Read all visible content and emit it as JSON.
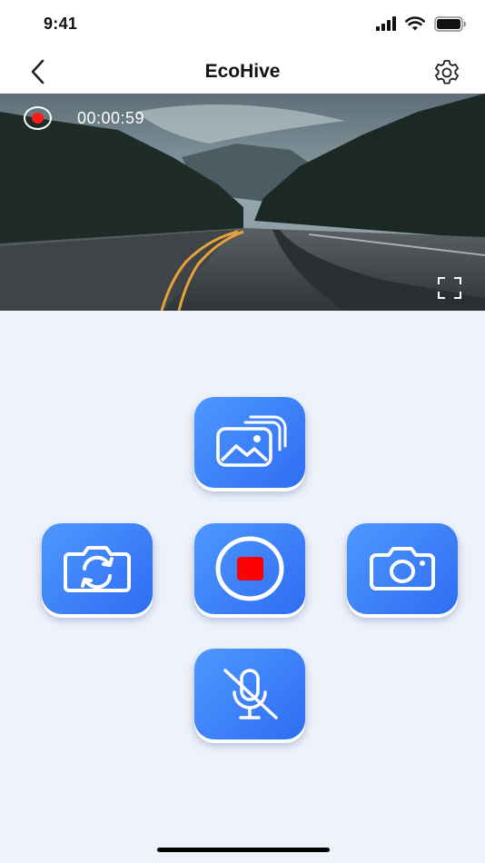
{
  "status_bar": {
    "time": "9:41",
    "icons": [
      "cellular-signal-icon",
      "wifi-icon",
      "battery-icon"
    ]
  },
  "nav": {
    "title": "EcoHive",
    "back_icon": "chevron-left-icon",
    "settings_icon": "gear-icon"
  },
  "video": {
    "recording_indicator_color": "#ff1a1a",
    "timer": "00:00:59",
    "fullscreen_icon": "fullscreen-icon"
  },
  "controls": {
    "accent_color": "#3b7ff7",
    "gallery": {
      "icon": "gallery-icon"
    },
    "flip_camera": {
      "icon": "flip-camera-icon"
    },
    "record": {
      "icon": "stop-record-icon",
      "stop_color": "#ff0000"
    },
    "take_photo": {
      "icon": "camera-icon"
    },
    "microphone": {
      "icon": "microphone-muted-icon",
      "muted": true
    }
  }
}
